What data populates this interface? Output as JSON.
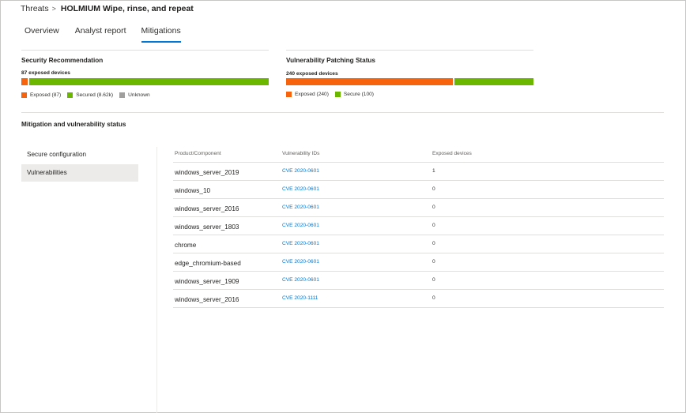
{
  "breadcrumb": {
    "root": "Threats",
    "separator": ">",
    "current": "HOLMIUM Wipe, rinse, and repeat"
  },
  "tabs": [
    {
      "label": "Overview",
      "active": false
    },
    {
      "label": "Analyst report",
      "active": false
    },
    {
      "label": "Mitigations",
      "active": true
    }
  ],
  "security_recommendation": {
    "title": "Security Recommendation",
    "subtitle": "87 exposed devices",
    "legend": [
      {
        "label": "Exposed (87)",
        "color": "#f7630c"
      },
      {
        "label": "Secured (8.62k)",
        "color": "#6bb700"
      },
      {
        "label": "Unknown",
        "color": "#a19f9d"
      }
    ],
    "bar": {
      "exposed_fraction": 0.026,
      "secured_fraction": 0.974
    }
  },
  "vulnerability_patching": {
    "title": "Vulnerability Patching Status",
    "subtitle": "240 exposed devices",
    "legend": [
      {
        "label": "Exposed (240)",
        "color": "#f7630c"
      },
      {
        "label": "Secure (100)",
        "color": "#6bb700"
      }
    ],
    "bar": {
      "exposed_fraction": 0.68,
      "secure_fraction": 0.32
    }
  },
  "mitigation": {
    "title": "Mitigation and vulnerability status",
    "sidebar": [
      {
        "label": "Secure configuration",
        "active": false
      },
      {
        "label": "Vulnerabilities",
        "active": true
      }
    ],
    "table": {
      "headers": [
        "Product/Component",
        "Vulnerability IDs",
        "Exposed devices"
      ],
      "rows": [
        {
          "product": "windows_server_2019",
          "cve": "CVE 2020-0601",
          "exposed": "1"
        },
        {
          "product": "windows_10",
          "cve": "CVE 2020-0601",
          "exposed": "0"
        },
        {
          "product": "windows_server_2016",
          "cve": "CVE 2020-0601",
          "exposed": "0"
        },
        {
          "product": "windows_server_1803",
          "cve": "CVE 2020-0601",
          "exposed": "0"
        },
        {
          "product": "chrome",
          "cve": "CVE 2020-0601",
          "exposed": "0"
        },
        {
          "product": "edge_chromium-based",
          "cve": "CVE 2020-0601",
          "exposed": "0"
        },
        {
          "product": "windows_server_1909",
          "cve": "CVE 2020-0601",
          "exposed": "0"
        },
        {
          "product": "windows_server_2016",
          "cve": "CVE 2020-1111",
          "exposed": "0"
        }
      ]
    }
  },
  "colors": {
    "accent": "#0078d4",
    "exposed": "#f7630c",
    "secured": "#6bb700",
    "unknown": "#a19f9d"
  }
}
